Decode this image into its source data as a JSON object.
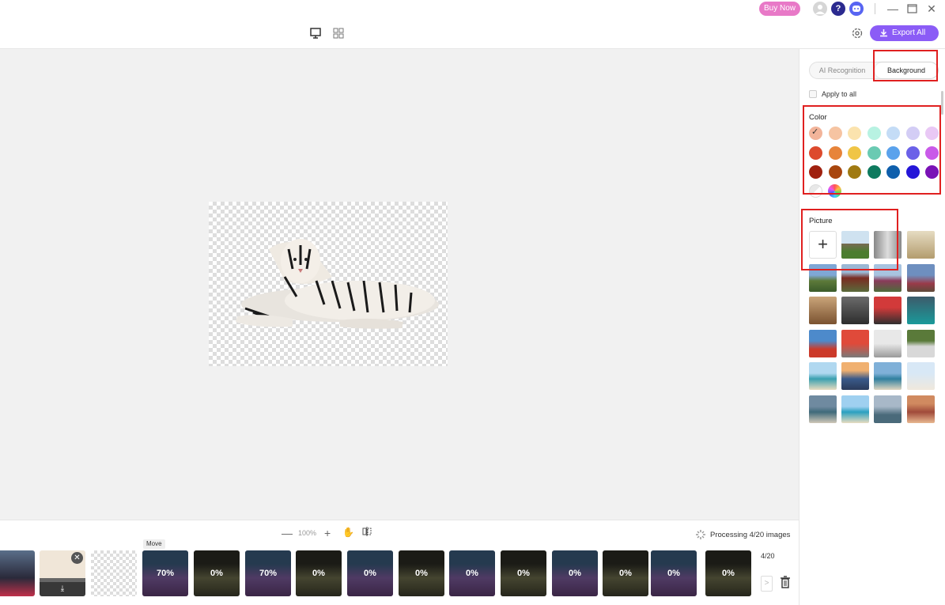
{
  "titlebar": {
    "buy_label": "Buy Now",
    "help_glyph": "?"
  },
  "toolbar": {
    "export_label": "Export All"
  },
  "panel": {
    "tabs": [
      {
        "label": "AI Recognition",
        "active": false
      },
      {
        "label": "Background",
        "active": true
      }
    ],
    "apply_all_label": "Apply to all",
    "color_title": "Color",
    "picture_title": "Picture",
    "colors": [
      "#f2b49a",
      "#f6c4a2",
      "#fbe3ae",
      "#b8f2e2",
      "#c4dcf6",
      "#d3cdf5",
      "#e9c8f5",
      "#dd4a2d",
      "#e7843a",
      "#f0c546",
      "#6acab2",
      "#5aa2ec",
      "#6b61e8",
      "#c95ae9",
      "#a0210f",
      "#a8460f",
      "#a07a12",
      "#0e7a5e",
      "#0f5fac",
      "#2516d8",
      "#7a12b6"
    ],
    "selected_color_index": 0,
    "add_label": "+"
  },
  "bottom": {
    "zoom_minus": "—",
    "zoom_value": "100%",
    "zoom_plus": "+",
    "processing_label": "Processing 4/20 images",
    "move_tooltip": "Move",
    "counter": "4/20",
    "next_arrow": ">",
    "filmstrip": [
      "",
      "",
      "",
      "70%",
      "0%",
      "70%",
      "0%",
      "0%",
      "0%",
      "0%",
      "0%",
      "0%",
      "0%",
      "0%",
      "0%"
    ]
  }
}
